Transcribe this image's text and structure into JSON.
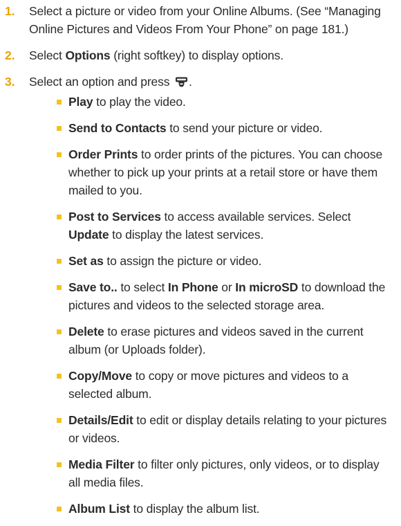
{
  "steps": [
    {
      "number": "1.",
      "text": "Select a picture or video from your Online Albums. (See “Managing Online Pictures and Videos From Your Phone” on page 181.)"
    },
    {
      "number": "2.",
      "pre": "Select ",
      "bold": "Options",
      "post": " (right softkey) to display options."
    },
    {
      "number": "3.",
      "pre": "Select an option and press ",
      "key_icon": "menu-ok-key-icon",
      "post": ".",
      "options": [
        {
          "term": "Play",
          "desc": " to play the video."
        },
        {
          "term": "Send to Contacts",
          "desc": " to send your picture or video."
        },
        {
          "term": "Order Prints",
          "desc": " to order prints of the pictures. You can choose whether to pick up your prints at a retail store or have them mailed to you."
        },
        {
          "term": "Post to Services",
          "desc": " to access available services. Select ",
          "term2": "Update",
          "desc2": " to display the latest services."
        },
        {
          "term": "Set as",
          "desc": " to assign the picture or video."
        },
        {
          "term": "Save to..",
          "desc": " to select ",
          "term2": "In Phone",
          "desc2": " or ",
          "term3": "In microSD",
          "desc3": " to download the pictures and videos to the selected storage area."
        },
        {
          "term": "Delete",
          "desc": " to erase pictures and videos saved in the current album (or Uploads folder)."
        },
        {
          "term": "Copy/Move",
          "desc": " to copy or move pictures and videos to a selected album."
        },
        {
          "term": "Details/Edit",
          "desc": " to edit or display details relating to your pictures or videos."
        },
        {
          "term": "Media Filter",
          "desc": " to filter only pictures, only videos, or to display all media files."
        },
        {
          "term": "Album List",
          "desc": " to display the album list."
        }
      ]
    }
  ],
  "colors": {
    "text": "#2b2b2b",
    "step_number": "#e8a200",
    "bullet": "#f4c21b"
  }
}
